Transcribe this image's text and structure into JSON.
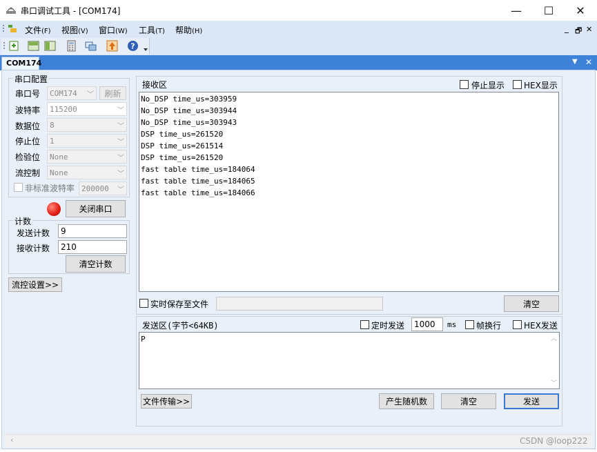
{
  "window": {
    "title": "串口调试工具 - [COM174]",
    "minimize_glyph": "—",
    "maximize_glyph": "☐",
    "close_glyph": "✕"
  },
  "menu": [
    {
      "label": "文件",
      "key": "(F)"
    },
    {
      "label": "视图",
      "key": "(V)"
    },
    {
      "label": "窗口",
      "key": "(W)"
    },
    {
      "label": "工具",
      "key": "(T)"
    },
    {
      "label": "帮助",
      "key": "(H)"
    }
  ],
  "mdi_controls": {
    "minimize": "_",
    "restore": "🗗",
    "close": "✕"
  },
  "toolbar_icons": [
    "new-icon",
    "split-horizontal-icon",
    "split-vertical-icon",
    "calculator-icon",
    "serial-window-icon",
    "upload-icon",
    "help-icon"
  ],
  "doc_tab": {
    "label": "COM174",
    "dropdown": "▼",
    "close": "✕"
  },
  "serial_config": {
    "group_title": "串口配置",
    "port_label": "串口号",
    "port_value": "COM174",
    "refresh_label": "刷新",
    "baud_label": "波特率",
    "baud_value": "115200",
    "databits_label": "数据位",
    "databits_value": "8",
    "stopbits_label": "停止位",
    "stopbits_value": "1",
    "parity_label": "检验位",
    "parity_value": "None",
    "flow_label": "流控制",
    "flow_value": "None",
    "custom_baud_label": "非标准波特率",
    "custom_baud_value": "200000",
    "close_port_label": "关闭串口",
    "status_color": "#e21b12"
  },
  "counter": {
    "group_title": "计数",
    "send_label": "发送计数",
    "send_value": "9",
    "recv_label": "接收计数",
    "recv_value": "210",
    "clear_label": "清空计数"
  },
  "flow_settings_label": "流控设置>>",
  "receive": {
    "title": "接收区",
    "stop_display_label": "停止显示",
    "hex_display_label": "HEX显示",
    "lines": [
      "No_DSP time_us=303959",
      "No_DSP time_us=303944",
      "No_DSP time_us=303943",
      "DSP time_us=261520",
      "DSP time_us=261514",
      "DSP time_us=261520",
      "fast table time_us=184064",
      "fast table time_us=184065",
      "fast table time_us=184066"
    ],
    "realtime_save_label": "实时保存至文件",
    "clear_label": "清空"
  },
  "send": {
    "title": "发送区(字节<64KB)",
    "timed_send_label": "定时发送",
    "interval_value": "1000",
    "interval_unit": "ms",
    "frame_newline_label": "帧换行",
    "hex_send_label": "HEX发送",
    "content": "P",
    "file_transfer_label": "文件传输>>",
    "random_label": "产生随机数",
    "clear_label": "清空",
    "send_label": "发送"
  },
  "watermark": "CSDN @loop222"
}
